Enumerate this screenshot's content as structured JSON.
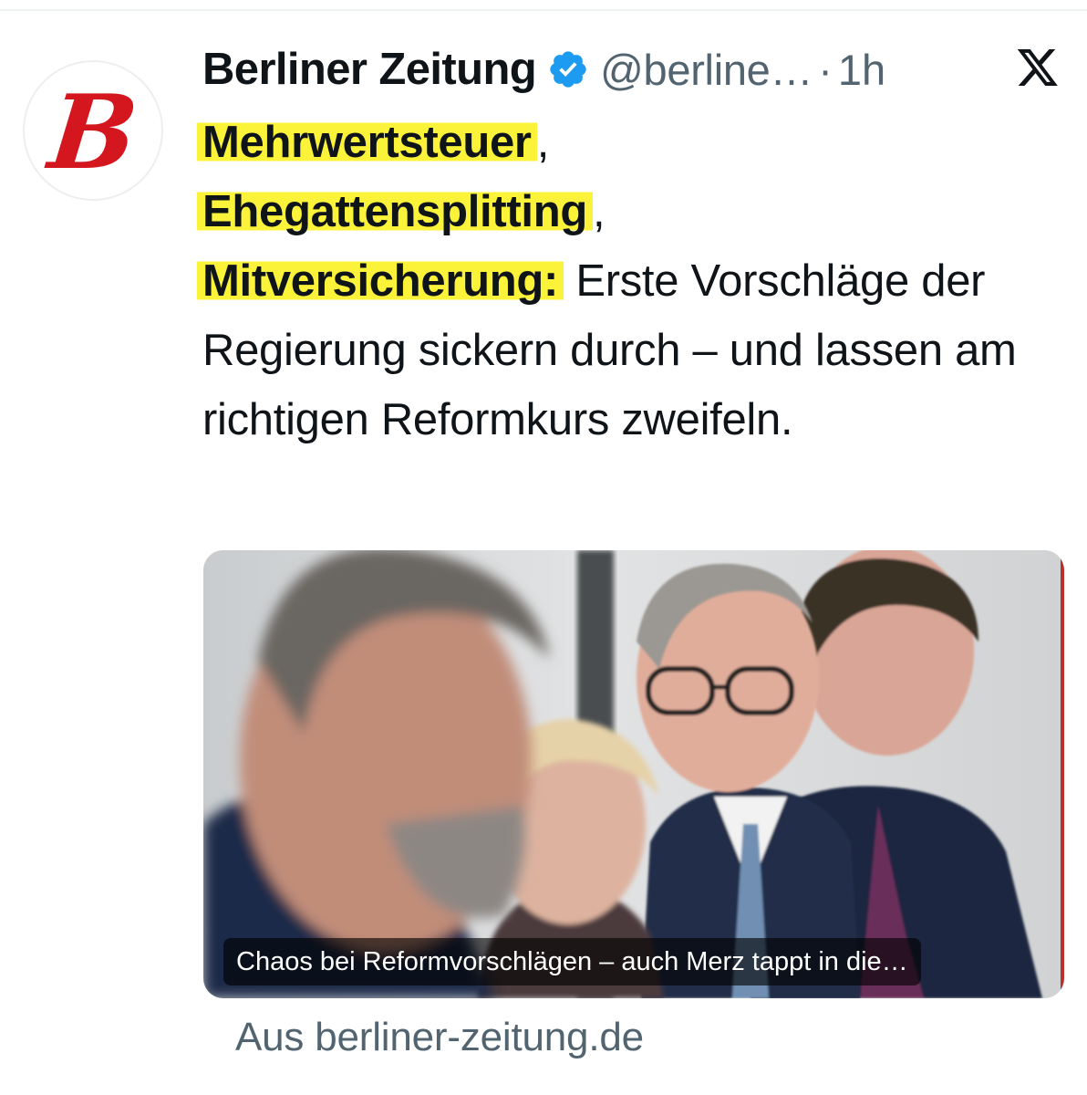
{
  "account": {
    "name": "Berliner Zeitung",
    "handle": "@berline…",
    "separator": "·",
    "time": "1h",
    "avatar_letter": "B",
    "verified_icon": "verified-badge-icon",
    "verified_color": "#1d9bf0",
    "logo_color": "#d4161f"
  },
  "platform_icon": "x-logo-icon",
  "tweet": {
    "highlight_1": "Mehrwertsteuer",
    "after_1": ",",
    "highlight_2": "Ehegattensplitting",
    "after_2": ",",
    "highlight_3": "Mitversicherung:",
    "body": " Erste Vorschläge der Regierung sickern durch – und lassen am richtigen Reformkurs zweifeln.",
    "highlight_color": "#fbf33a"
  },
  "link_card": {
    "caption": "Chaos bei Reformvorschlägen – auch Merz tappt in die…",
    "source": "Aus berliner-zeitung.de"
  }
}
